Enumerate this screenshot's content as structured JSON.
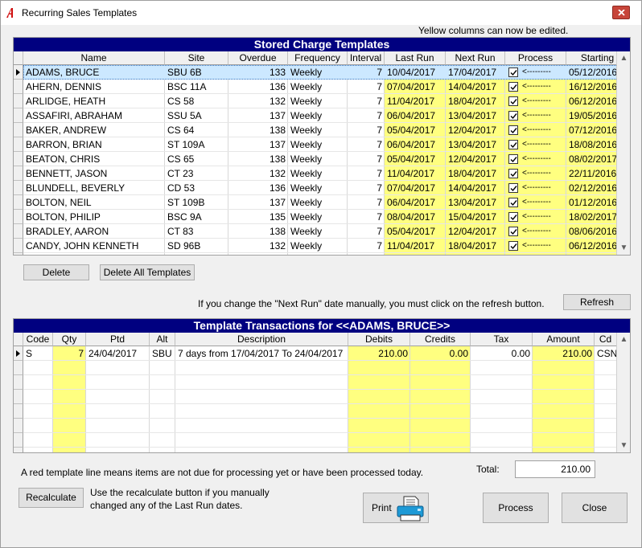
{
  "window": {
    "title": "Recurring Sales Templates"
  },
  "top_hint": "Yellow columns can now be edited.",
  "charges": {
    "title": "Stored Charge Templates",
    "columns": [
      "Name",
      "Site",
      "Overdue",
      "Frequency",
      "Interval",
      "Last Run",
      "Next Run",
      "Process",
      "Starting"
    ],
    "rows": [
      {
        "name": "ADAMS, BRUCE",
        "site": "SBU  6B",
        "overdue": "133",
        "frequency": "Weekly",
        "interval": "7",
        "last_run": "10/04/2017",
        "next_run": "17/04/2017",
        "process": "<---------",
        "starting": "05/12/2016"
      },
      {
        "name": "AHERN, DENNIS",
        "site": "BSC  11A",
        "overdue": "136",
        "frequency": "Weekly",
        "interval": "7",
        "last_run": "07/04/2017",
        "next_run": "14/04/2017",
        "process": "<---------",
        "starting": "16/12/2016"
      },
      {
        "name": "ARLIDGE, HEATH",
        "site": "CS   58",
        "overdue": "132",
        "frequency": "Weekly",
        "interval": "7",
        "last_run": "11/04/2017",
        "next_run": "18/04/2017",
        "process": "<---------",
        "starting": "06/12/2016"
      },
      {
        "name": "ASSAFIRI, ABRAHAM",
        "site": "SSU  5A",
        "overdue": "137",
        "frequency": "Weekly",
        "interval": "7",
        "last_run": "06/04/2017",
        "next_run": "13/04/2017",
        "process": "<---------",
        "starting": "19/05/2016"
      },
      {
        "name": "BAKER, ANDREW",
        "site": "CS   64",
        "overdue": "138",
        "frequency": "Weekly",
        "interval": "7",
        "last_run": "05/04/2017",
        "next_run": "12/04/2017",
        "process": "<---------",
        "starting": "07/12/2016"
      },
      {
        "name": "BARRON, BRIAN",
        "site": "ST  109A",
        "overdue": "137",
        "frequency": "Weekly",
        "interval": "7",
        "last_run": "06/04/2017",
        "next_run": "13/04/2017",
        "process": "<---------",
        "starting": "18/08/2016"
      },
      {
        "name": "BEATON, CHRIS",
        "site": "CS   65",
        "overdue": "138",
        "frequency": "Weekly",
        "interval": "7",
        "last_run": "05/04/2017",
        "next_run": "12/04/2017",
        "process": "<---------",
        "starting": "08/02/2017"
      },
      {
        "name": "BENNETT, JASON",
        "site": "CT   23",
        "overdue": "132",
        "frequency": "Weekly",
        "interval": "7",
        "last_run": "11/04/2017",
        "next_run": "18/04/2017",
        "process": "<---------",
        "starting": "22/11/2016"
      },
      {
        "name": "BLUNDELL, BEVERLY",
        "site": "CD   53",
        "overdue": "136",
        "frequency": "Weekly",
        "interval": "7",
        "last_run": "07/04/2017",
        "next_run": "14/04/2017",
        "process": "<---------",
        "starting": "02/12/2016"
      },
      {
        "name": "BOLTON, NEIL",
        "site": "ST  109B",
        "overdue": "137",
        "frequency": "Weekly",
        "interval": "7",
        "last_run": "06/04/2017",
        "next_run": "13/04/2017",
        "process": "<---------",
        "starting": "01/12/2016"
      },
      {
        "name": "BOLTON, PHILIP",
        "site": "BSC  9A",
        "overdue": "135",
        "frequency": "Weekly",
        "interval": "7",
        "last_run": "08/04/2017",
        "next_run": "15/04/2017",
        "process": "<---------",
        "starting": "18/02/2017"
      },
      {
        "name": "BRADLEY, AARON",
        "site": "CT   83",
        "overdue": "138",
        "frequency": "Weekly",
        "interval": "7",
        "last_run": "05/04/2017",
        "next_run": "12/04/2017",
        "process": "<---------",
        "starting": "08/06/2016"
      },
      {
        "name": "CANDY, JOHN KENNETH",
        "site": "SD   96B",
        "overdue": "132",
        "frequency": "Weekly",
        "interval": "7",
        "last_run": "11/04/2017",
        "next_run": "18/04/2017",
        "process": "<---------",
        "starting": "06/12/2016"
      }
    ]
  },
  "buttons": {
    "delete": "Delete",
    "delete_all": "Delete All Templates",
    "refresh": "Refresh",
    "recalculate": "Recalculate",
    "print": "Print",
    "process": "Process",
    "close": "Close"
  },
  "refresh_hint": "If you change the \"Next Run\" date manually, you must click on the refresh button.",
  "transactions": {
    "title": "Template Transactions for <<ADAMS, BRUCE>>",
    "columns": [
      "Code",
      "Qty",
      "Ptd",
      "Alt",
      "Description",
      "Debits",
      "Credits",
      "Tax",
      "Amount",
      "Cd"
    ],
    "rows": [
      {
        "code": "S",
        "qty": "7",
        "ptd": "24/04/2017",
        "alt": "SBU",
        "description": "7 days from 17/04/2017 To 24/04/2017",
        "debits": "210.00",
        "credits": "0.00",
        "tax": "0.00",
        "amount": "210.00",
        "cd": "CSN"
      }
    ]
  },
  "red_note": "A red template line means items are not due  for processing yet or have been processed today.",
  "total": {
    "label": "Total:",
    "value": "210.00"
  },
  "recalc_hint_1": "Use the recalculate button if you manually",
  "recalc_hint_2": "changed any of the Last Run dates.",
  "colors": {
    "header_bar": "#000080",
    "editable": "#ffff80",
    "selected_row": "#cce8ff"
  },
  "icons": [
    "app-logo-icon",
    "close-icon",
    "row-pointer-icon",
    "checkbox-checked-icon",
    "scroll-up-icon",
    "scroll-down-icon",
    "printer-icon"
  ]
}
